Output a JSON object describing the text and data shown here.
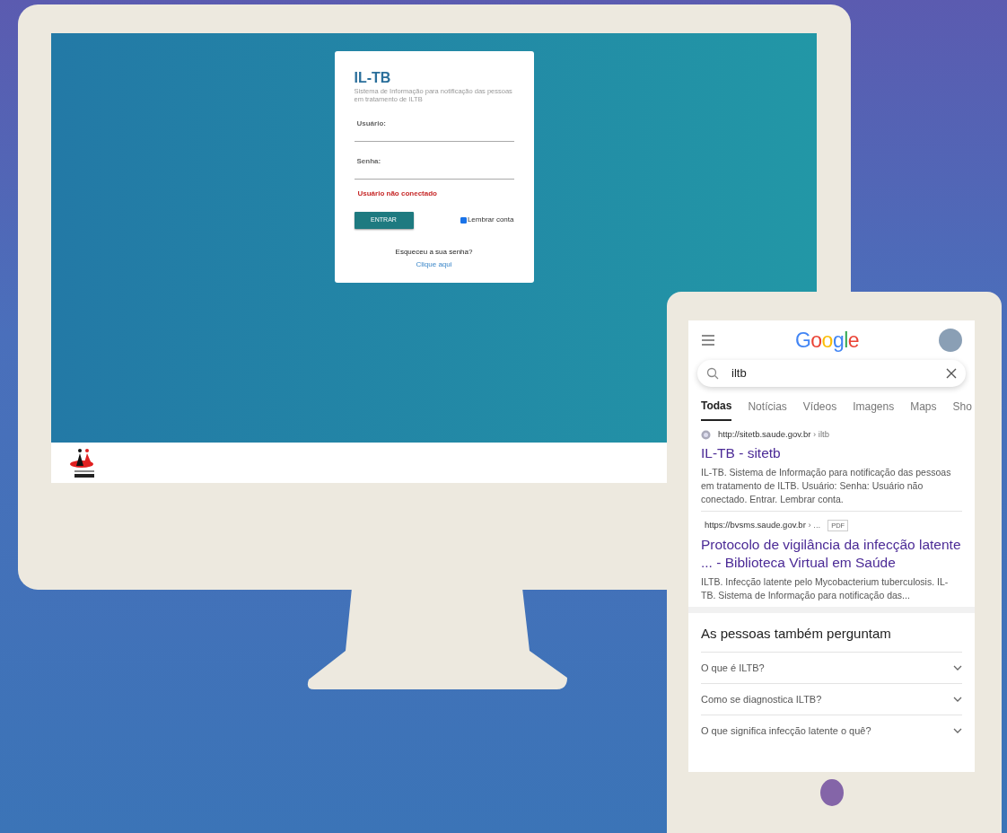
{
  "login": {
    "title": "IL-TB",
    "subtitle": "Sistema de Informação para notificação das pessoas em tratamento de ILTB",
    "fields": [
      {
        "label": "Usuário:"
      },
      {
        "label": "Senha:"
      }
    ],
    "error": "Usuário não conectado",
    "button": "ENTRAR",
    "remember": {
      "label": "Lembrar conta",
      "checked": true
    },
    "forgot": "Esqueceu a sua senha?",
    "link": "Clique aqui"
  },
  "search": {
    "logo": "Google",
    "query": "iltb",
    "tabs": [
      {
        "label": "Todas",
        "selected": true
      },
      {
        "label": "Notícias",
        "selected": false
      },
      {
        "label": "Vídeos",
        "selected": false
      },
      {
        "label": "Imagens",
        "selected": false
      },
      {
        "label": "Maps",
        "selected": false
      },
      {
        "label": "Sho",
        "selected": false
      }
    ],
    "results": [
      {
        "url": "http://sitetb.saude.gov.br",
        "path": "› iltb",
        "title": "IL-TB - sitetb",
        "snippet": "IL-TB. Sistema de Informação para notificação das pessoas em tratamento de ILTB. Usuário: Senha: Usuário não conectado. Entrar. Lembrar conta."
      },
      {
        "url": "https://bvsms.saude.gov.br",
        "path": "› ...",
        "badge": "PDF",
        "title": "Protocolo de vigilância da infecção latente ... - Biblioteca Virtual em Saúde",
        "snippet": "ILTB. Infecção latente pelo Mycobacterium tuberculosis. IL-TB. Sistema de Informação para notificação das..."
      }
    ],
    "questions_heading": "As pessoas também perguntam",
    "questions": [
      "O que é ILTB?",
      "Como se diagnostica ILTB?",
      "O que significa infecção latente o quê?"
    ]
  }
}
